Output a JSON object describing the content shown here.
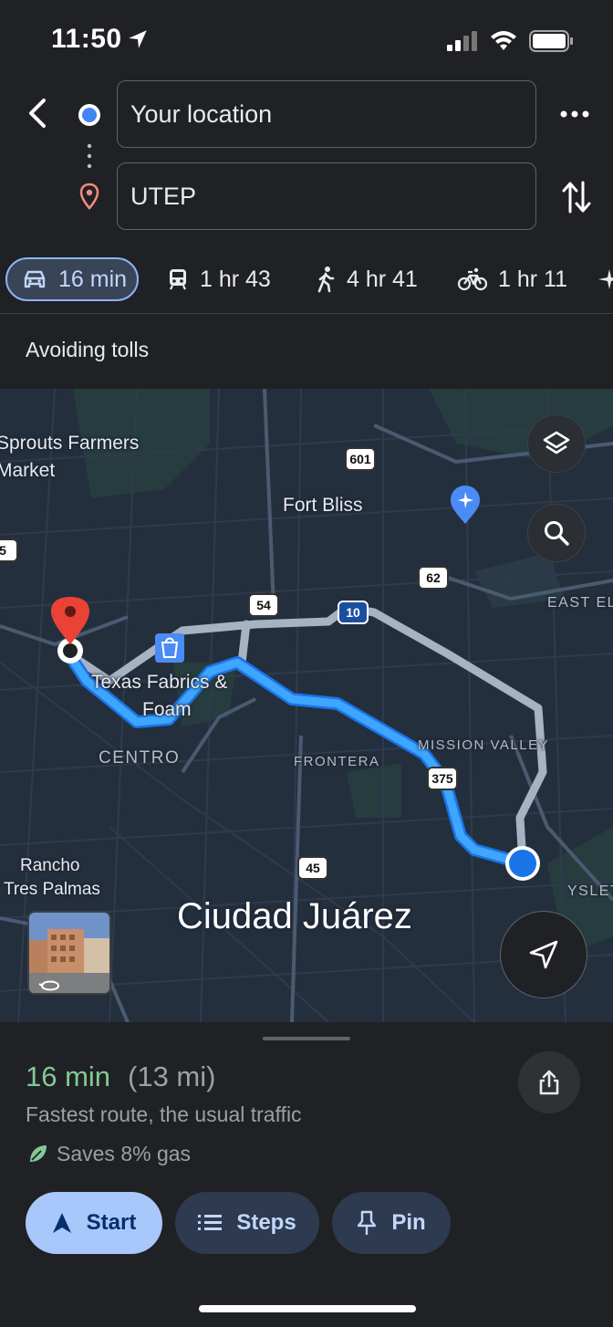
{
  "status": {
    "time": "11:50"
  },
  "directions": {
    "origin": "Your location",
    "destination": "UTEP",
    "modes": [
      {
        "name": "car",
        "label": "16 min"
      },
      {
        "name": "transit",
        "label": "1 hr 43"
      },
      {
        "name": "walk",
        "label": "4 hr 41"
      },
      {
        "name": "bike",
        "label": "1 hr 11"
      }
    ],
    "avoid_note": "Avoiding tolls"
  },
  "map": {
    "labels": {
      "sprouts": "Sprouts Farmers",
      "sprouts2": "Market",
      "fort_bliss": "Fort Bliss",
      "east_el": "EAST EL",
      "texas_fabrics": "Texas Fabrics &",
      "texas_fabrics2": "Foam",
      "centro": "CENTRO",
      "frontera": "FRONTERA",
      "mission_valley": "MISSION VALLEY",
      "rancho": "Rancho",
      "rancho2": "Tres Palmas",
      "ciudad": "Ciudad Juárez",
      "yslet": "YSLET"
    },
    "shields": {
      "s601": "601",
      "s62": "62",
      "s54": "54",
      "s10": "10",
      "s375": "375",
      "s45": "45",
      "s5": "5"
    },
    "route_color": "#3ea6ff",
    "alt_route_color": "#a5b3c2"
  },
  "route": {
    "time": "16 min",
    "distance": "(13 mi)",
    "description": "Fastest route, the usual traffic",
    "gas": "Saves 8% gas"
  },
  "actions": {
    "start": "Start",
    "steps": "Steps",
    "pin": "Pin"
  },
  "colors": {
    "accent": "#8ab4f8",
    "time_green": "#81c995",
    "origin_blue": "#4285f4",
    "pin_red": "#ea4335"
  }
}
